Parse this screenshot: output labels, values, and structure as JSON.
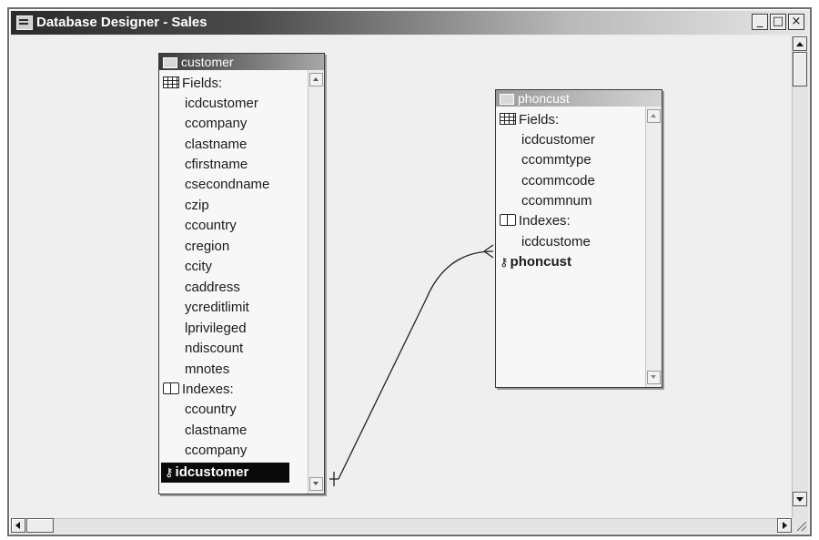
{
  "window": {
    "title": "Database Designer - Sales",
    "icon": "database-designer-icon",
    "buttons": [
      "_",
      "□",
      "×"
    ]
  },
  "tables": [
    {
      "name": "customer",
      "active": true,
      "fields_label": "Fields:",
      "fields": [
        "icdcustomer",
        "ccompany",
        "clastname",
        "cfirstname",
        "csecondname",
        "czip",
        "ccountry",
        "cregion",
        "ccity",
        "caddress",
        "ycreditlimit",
        "lprivileged",
        "ndiscount",
        "mnotes"
      ],
      "indexes_label": "Indexes:",
      "indexes": [
        "ccountry",
        "clastname",
        "ccompany"
      ],
      "primary_key": "idcustomer"
    },
    {
      "name": "phoncust",
      "active": false,
      "fields_label": "Fields:",
      "fields": [
        "icdcustomer",
        "ccommtype",
        "ccommcode",
        "ccommnum"
      ],
      "indexes_label": "Indexes:",
      "indexes": [
        "icdcustome"
      ],
      "primary_key": "phoncust"
    }
  ],
  "relation": {
    "from": "customer.idcustomer",
    "to": "phoncust.icdcustome",
    "type": "one-to-many"
  }
}
